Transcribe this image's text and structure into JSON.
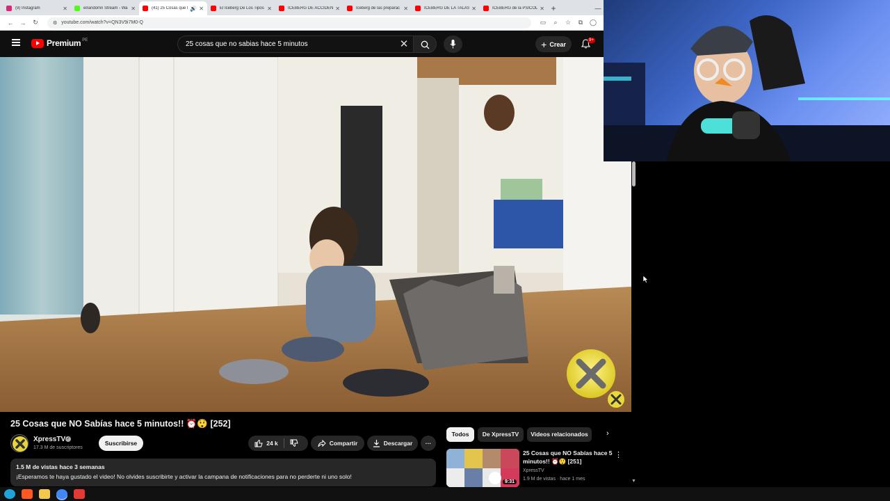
{
  "browser": {
    "tabs": [
      {
        "title": "(9) Instagram",
        "color": "#d62976"
      },
      {
        "title": "elrandomn Stream - Wa",
        "color": "#53fc18"
      },
      {
        "title": "(41) 25 Cosas que N",
        "color": "#ff0000",
        "active": true
      },
      {
        "title": "El Iceberg De Los Tipos",
        "color": "#ff0000"
      },
      {
        "title": "ICEBERG DE ACCIDENTE",
        "color": "#ff0000"
      },
      {
        "title": "Iceberg de las preparac",
        "color": "#ff0000"
      },
      {
        "title": "ICEBERG DE LA TALASO",
        "color": "#ff0000"
      },
      {
        "title": "ICEBERG de la PSICOLO",
        "color": "#ff0000"
      }
    ],
    "url": "youtube.com/watch?v=QN3V9i7M0-Q"
  },
  "header": {
    "logo_text": "Premium",
    "country_code": "PE",
    "search_value": "25 cosas que no sabias hace 5 minutos",
    "create_label": "Crear",
    "notifications_badge": "9+"
  },
  "video": {
    "title": "25 Cosas que NO Sabías hace 5 minutos!! ⏰😲 [252]",
    "channel": "XpressTV",
    "subscribers": "17.3 M de suscriptores",
    "subscribe_label": "Suscribirse",
    "likes": "24 k",
    "share_label": "Compartir",
    "download_label": "Descargar",
    "more_label": "···",
    "description_meta": "1.5 M de vistas  hace 3 semanas",
    "description_text": "¡Esperamos te haya gustado el video! No olvides suscribirte y activar la campana de notificaciones para no perderte ni uno solo!"
  },
  "chips": [
    "Todos",
    "De XpressTV",
    "Videos relacionados"
  ],
  "recommended": [
    {
      "title": "25 Cosas que NO Sabías hace 5 minutos!! ⏰😲 [251]",
      "channel": "XpressTV",
      "meta": "1.9 M de vistas · hace 1 mes",
      "duration": "9:31"
    }
  ]
}
